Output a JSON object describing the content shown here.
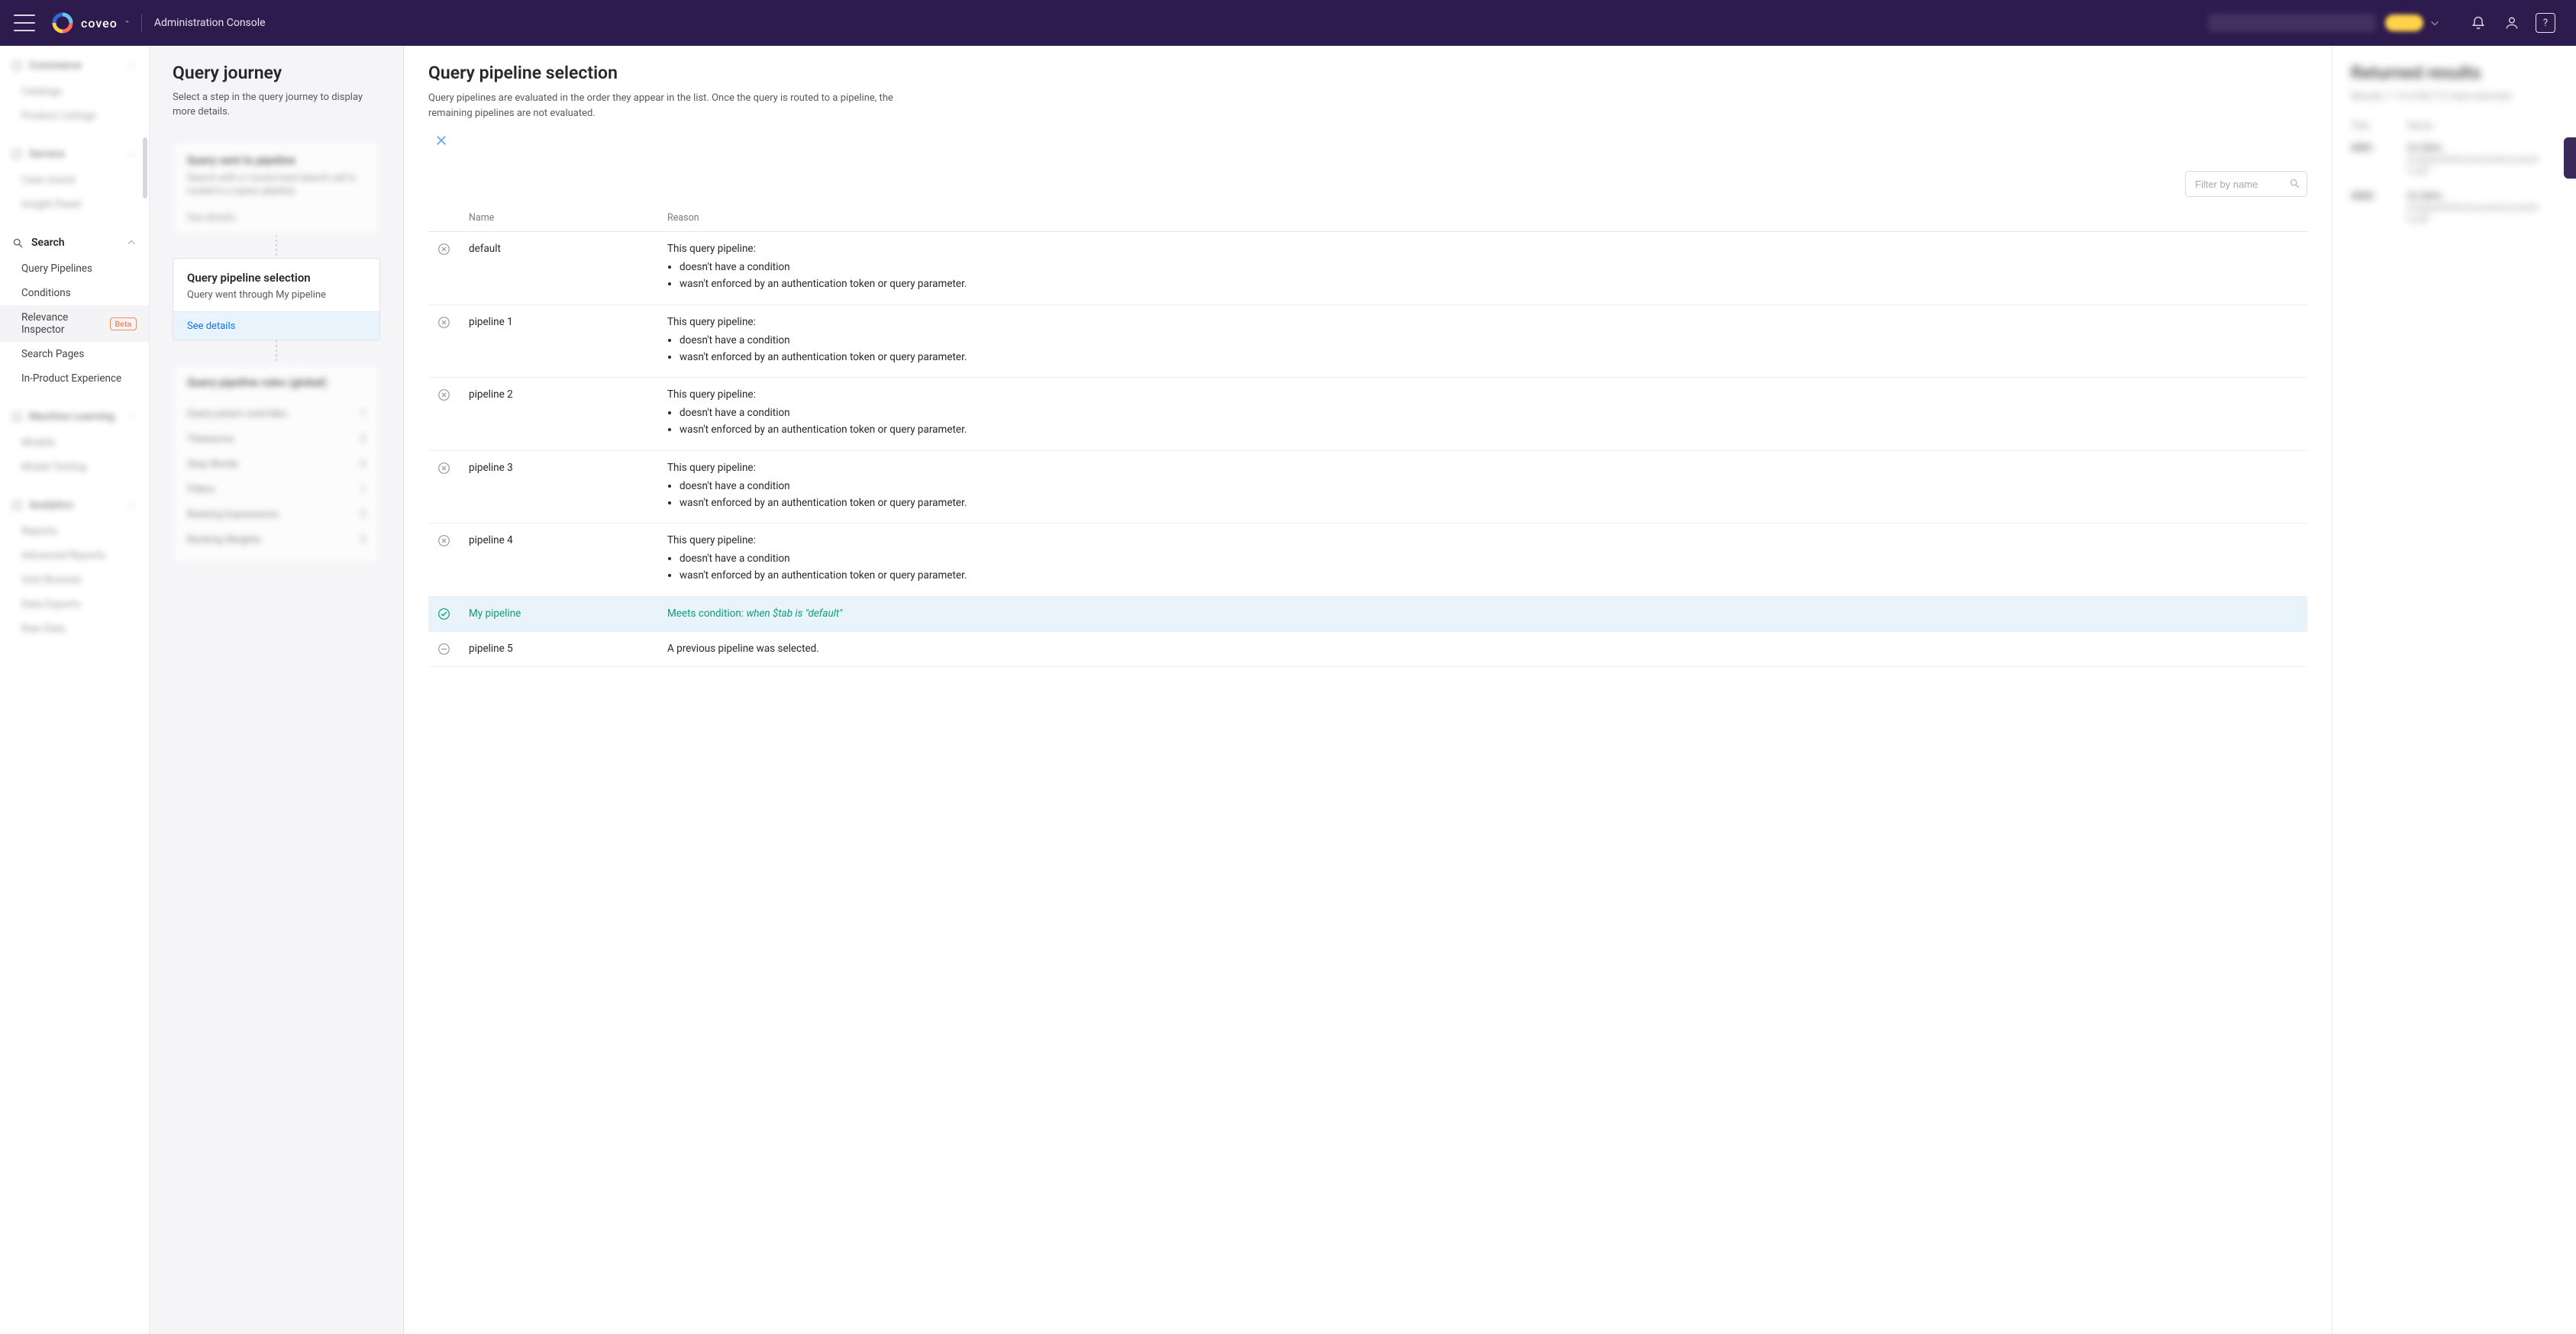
{
  "header": {
    "brand": "coveo",
    "product": "Administration Console"
  },
  "sidebar": {
    "blur_groups": [
      {
        "title": "Commerce",
        "items": [
          "Catalogs",
          "Product Listings"
        ]
      },
      {
        "title": "Service",
        "items": [
          "Case Assist",
          "Insight Panel"
        ]
      }
    ],
    "search": {
      "title": "Search",
      "items": [
        {
          "label": "Query Pipelines"
        },
        {
          "label": "Conditions"
        },
        {
          "label": "Relevance Inspector",
          "badge": "Beta",
          "active": true
        },
        {
          "label": "Search Pages"
        },
        {
          "label": "In-Product Experience"
        }
      ]
    },
    "blur_groups_after": [
      {
        "title": "Machine Learning",
        "items": [
          "Models",
          "Model Testing"
        ]
      },
      {
        "title": "Analytics",
        "items": [
          "Reports",
          "Advanced Reports",
          "Visit Browser",
          "Data Exports",
          "Raw Data"
        ]
      }
    ]
  },
  "journey": {
    "title": "Query journey",
    "desc": "Select a step in the query journey to display more details.",
    "step1": {
      "title": "Query sent to pipeline",
      "sub": "Search with a /coveo/rest/search call is routed to a query pipeline.",
      "see": "See details"
    },
    "step_active": {
      "title": "Query pipeline selection",
      "sub": "Query went through My pipeline",
      "see": "See details"
    },
    "step3": {
      "title": "Query pipeline rules (global)",
      "rows": [
        {
          "label": "Query param overrides",
          "count": "1"
        },
        {
          "label": "Thesaurus",
          "count": "0"
        },
        {
          "label": "Stop Words",
          "count": "0"
        },
        {
          "label": "Filters",
          "count": "1"
        },
        {
          "label": "Ranking Expressions",
          "count": "0"
        },
        {
          "label": "Ranking Weights",
          "count": "0"
        }
      ]
    }
  },
  "detail": {
    "title": "Query pipeline selection",
    "desc": "Query pipelines are evaluated in the order they appear in the list. Once the query is routed to a pipeline, the remaining pipelines are not evaluated.",
    "filter_placeholder": "Filter by name",
    "columns": {
      "name": "Name",
      "reason": "Reason"
    },
    "reason_intro": "This query pipeline:",
    "reason_bullets": [
      "doesn't have a condition",
      "wasn't enforced by an authentication token or query parameter."
    ],
    "rows": [
      {
        "name": "default",
        "status": "reject"
      },
      {
        "name": "pipeline 1",
        "status": "reject"
      },
      {
        "name": "pipeline 2",
        "status": "reject"
      },
      {
        "name": "pipeline 3",
        "status": "reject"
      },
      {
        "name": "pipeline 4",
        "status": "reject"
      },
      {
        "name": "My pipeline",
        "status": "accept",
        "reason_text": "Meets condition: ",
        "cond": "when $tab is \"default\""
      },
      {
        "name": "pipeline 5",
        "status": "skip",
        "reason_text": "A previous pipeline was selected."
      }
    ]
  },
  "results": {
    "title": "Returned results",
    "sub": "Results 1–5 of 84,712 were returned",
    "col1": "Title",
    "col2": "Name",
    "rows": [
      {
        "c1": "#001",
        "c2": "GLOBAL",
        "line2": "kropbendrehonsemediconwerk 0.pdf"
      },
      {
        "c1": "#002",
        "c2": "GLOBAL",
        "line2": "kropbendrehonsemediconwerk 0.pdf"
      }
    ]
  }
}
